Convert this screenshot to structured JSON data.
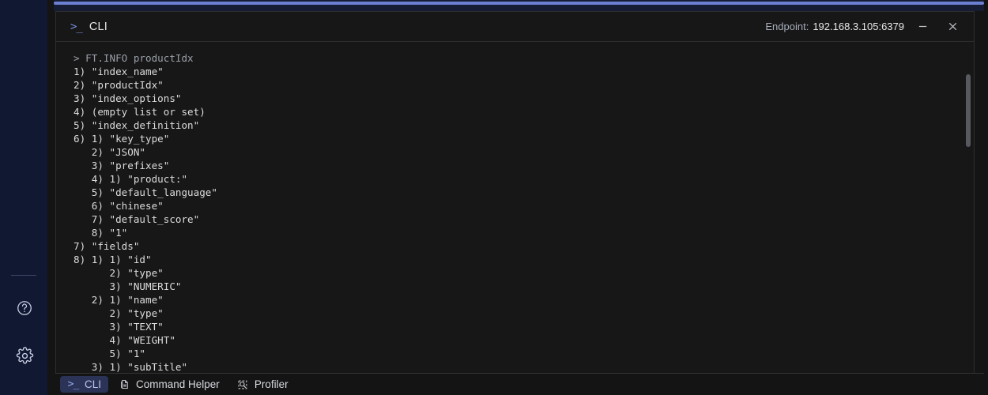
{
  "sidebar": {
    "help_icon": "help-circle-icon",
    "settings_icon": "gear-icon"
  },
  "cli_panel": {
    "prompt_glyph": ">_",
    "title": "CLI",
    "endpoint_label": "Endpoint:",
    "endpoint_value": "192.168.3.105:6379",
    "minimize_icon": "minimize-icon",
    "close_icon": "close-icon",
    "output_lines": [
      {
        "text": "> FT.INFO productIdx",
        "type": "command"
      },
      {
        "text": "1) \"index_name\"",
        "type": "result"
      },
      {
        "text": "2) \"productIdx\"",
        "type": "result"
      },
      {
        "text": "3) \"index_options\"",
        "type": "result"
      },
      {
        "text": "4) (empty list or set)",
        "type": "result"
      },
      {
        "text": "5) \"index_definition\"",
        "type": "result"
      },
      {
        "text": "6) 1) \"key_type\"",
        "type": "result"
      },
      {
        "text": "   2) \"JSON\"",
        "type": "result"
      },
      {
        "text": "   3) \"prefixes\"",
        "type": "result"
      },
      {
        "text": "   4) 1) \"product:\"",
        "type": "result"
      },
      {
        "text": "   5) \"default_language\"",
        "type": "result"
      },
      {
        "text": "   6) \"chinese\"",
        "type": "result"
      },
      {
        "text": "   7) \"default_score\"",
        "type": "result"
      },
      {
        "text": "   8) \"1\"",
        "type": "result"
      },
      {
        "text": "7) \"fields\"",
        "type": "result"
      },
      {
        "text": "8) 1) 1) \"id\"",
        "type": "result"
      },
      {
        "text": "      2) \"type\"",
        "type": "result"
      },
      {
        "text": "      3) \"NUMERIC\"",
        "type": "result"
      },
      {
        "text": "   2) 1) \"name\"",
        "type": "result"
      },
      {
        "text": "      2) \"type\"",
        "type": "result"
      },
      {
        "text": "      3) \"TEXT\"",
        "type": "result"
      },
      {
        "text": "      4) \"WEIGHT\"",
        "type": "result"
      },
      {
        "text": "      5) \"1\"",
        "type": "result"
      },
      {
        "text": "   3) 1) \"subTitle\"",
        "type": "result"
      }
    ]
  },
  "tabs": [
    {
      "label": "CLI",
      "icon": "prompt-icon",
      "active": true
    },
    {
      "label": "Command Helper",
      "icon": "document-icon",
      "active": false
    },
    {
      "label": "Profiler",
      "icon": "profiler-search-icon",
      "active": false
    }
  ],
  "colors": {
    "accent_bar": "#6c80d2",
    "rail_background": "#111831",
    "panel_background": "#171717",
    "active_tab_background": "#2b3357",
    "active_tab_text": "#b9c4ee"
  }
}
